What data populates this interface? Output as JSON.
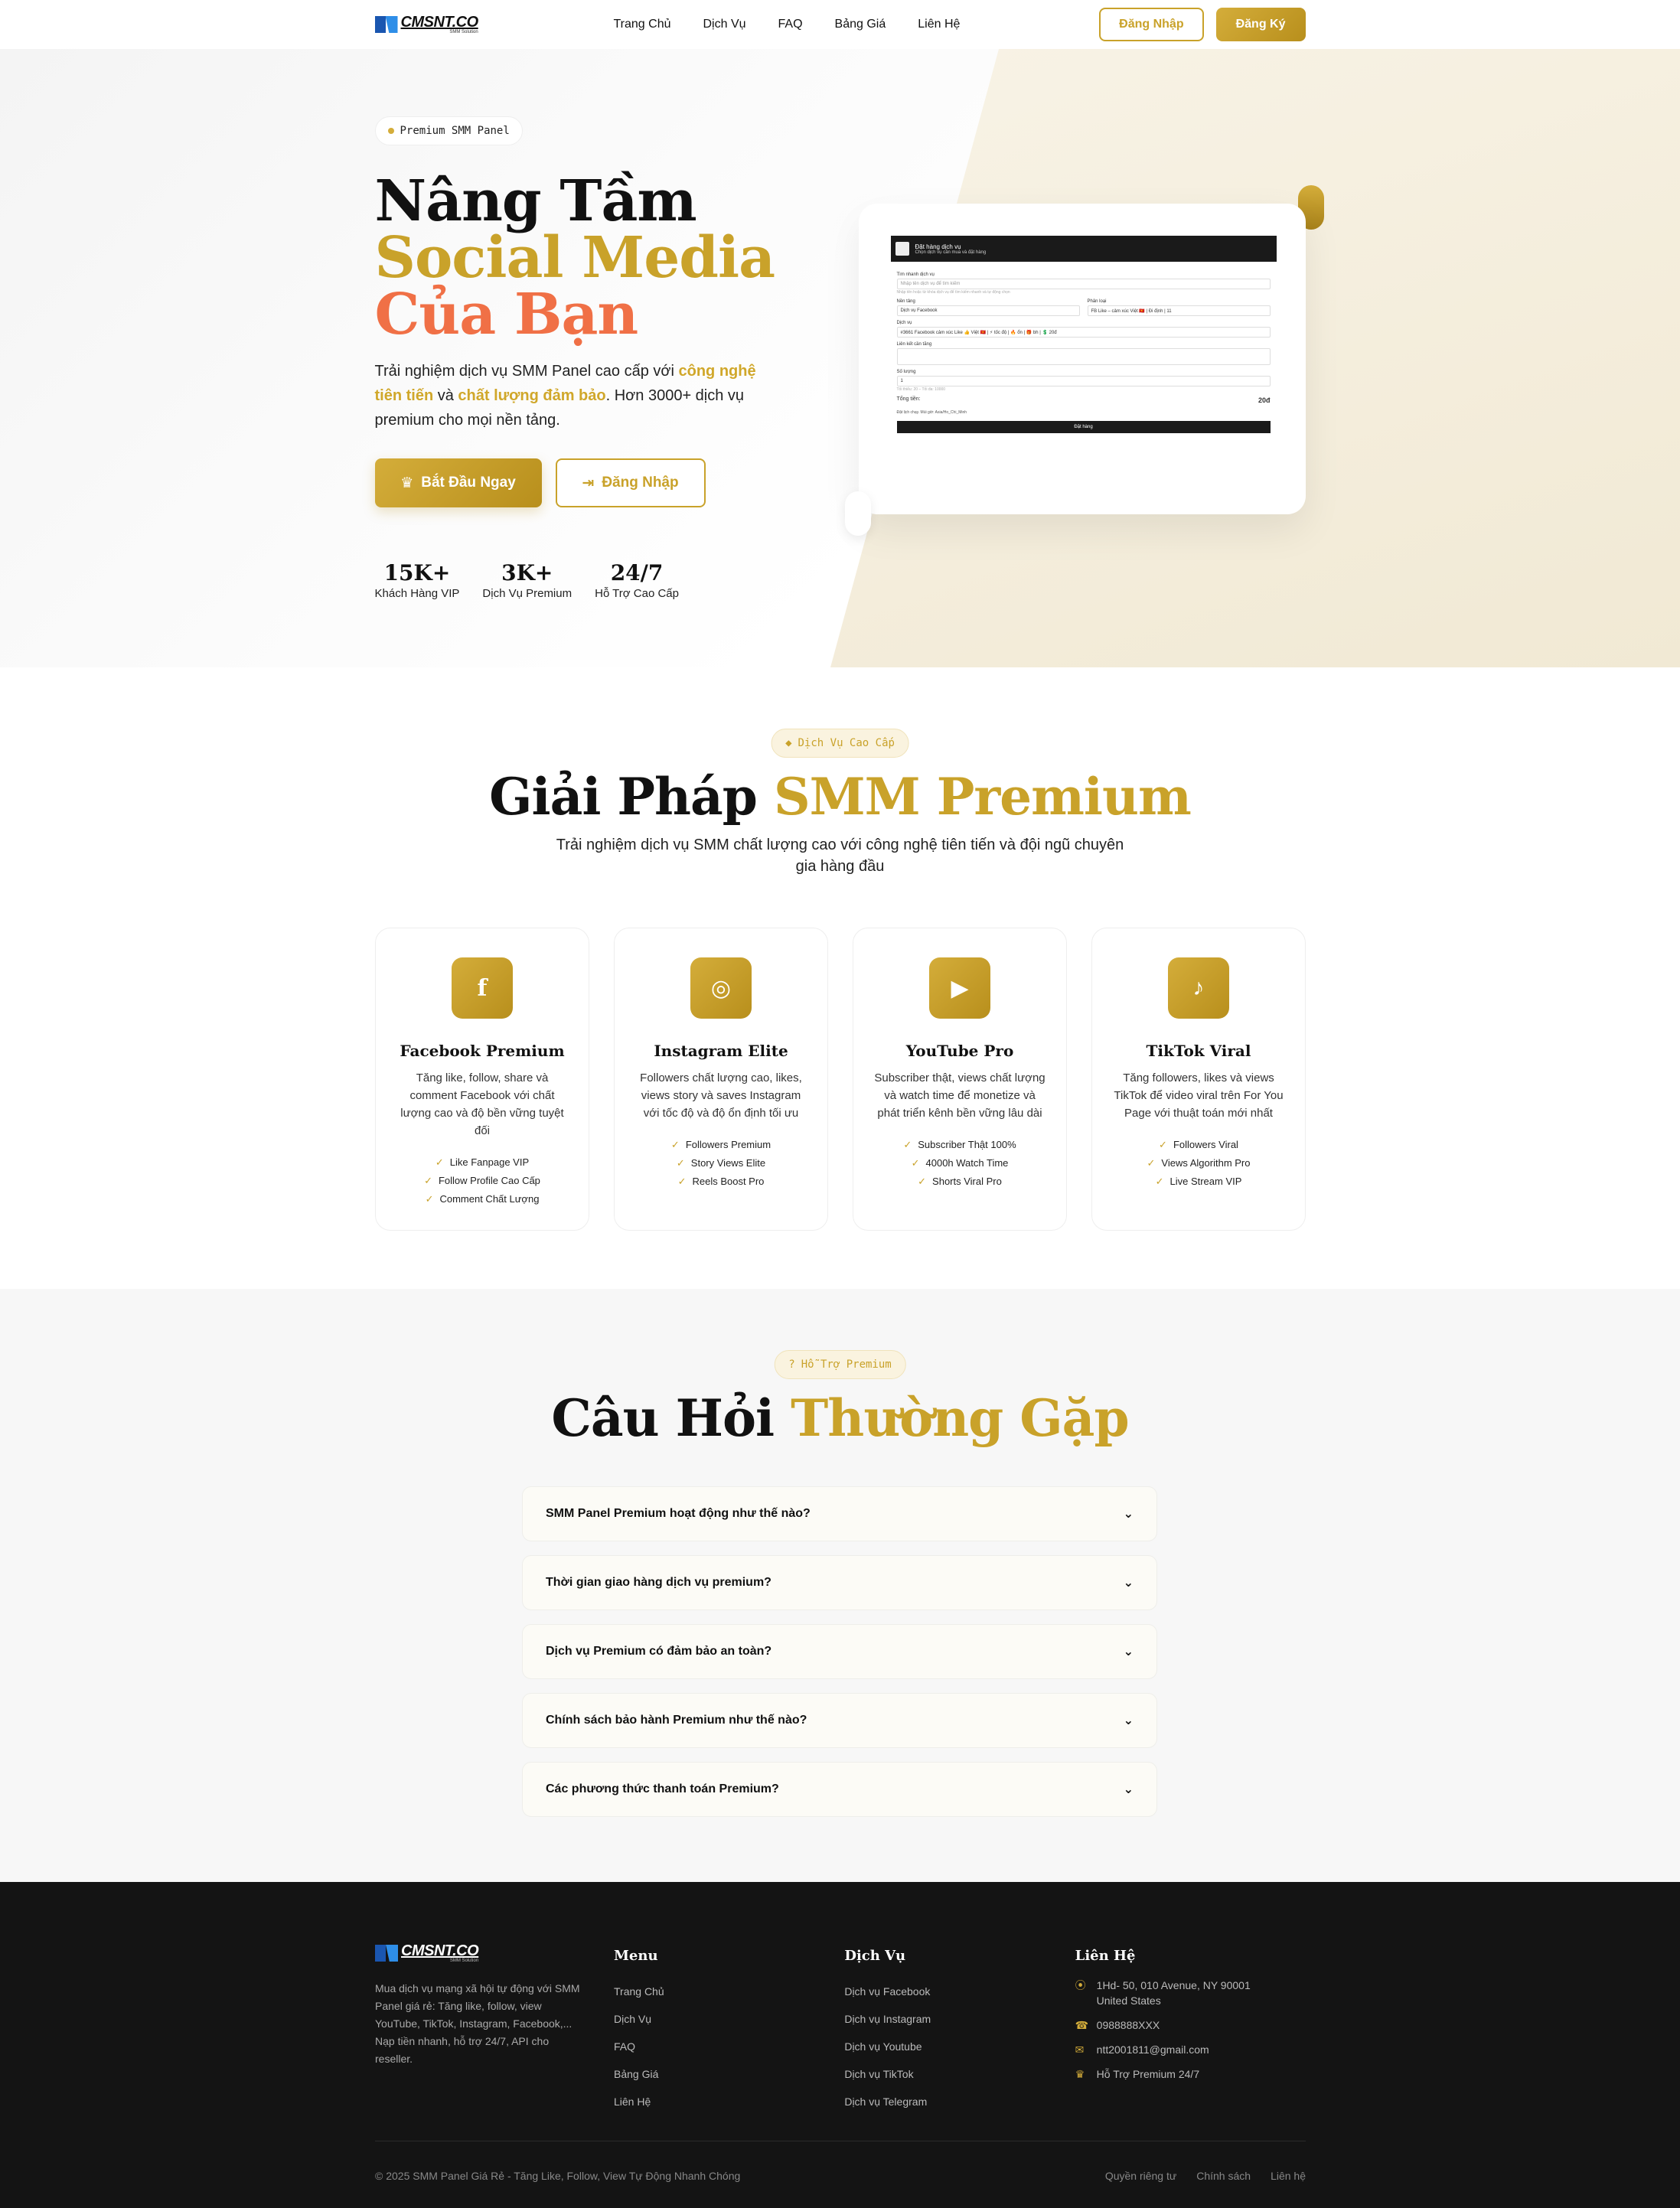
{
  "nav": {
    "logo_text": "CMSNT.CO",
    "logo_sub": "SMM Solution",
    "menu": [
      "Trang Chủ",
      "Dịch Vụ",
      "FAQ",
      "Bảng Giá",
      "Liên Hệ"
    ],
    "login": "Đăng Nhập",
    "register": "Đăng Ký"
  },
  "hero": {
    "badge": "Premium SMM Panel",
    "title_1": "Nâng Tầm",
    "title_2": "Social Media",
    "title_3": "Của Bạn",
    "desc_1": "Trải nghiệm dịch vụ SMM Panel cao cấp với ",
    "desc_hl_1": "công nghệ tiên tiến",
    "desc_2": " và ",
    "desc_hl_2": "chất lượng đảm bảo",
    "desc_3": ". Hơn 3000+ dịch vụ premium cho mọi nền tảng.",
    "btn_start": "Bắt Đầu Ngay",
    "btn_login": "Đăng Nhập",
    "stats": [
      {
        "num": "15K+",
        "label": "Khách Hàng VIP"
      },
      {
        "num": "3K+",
        "label": "Dịch Vụ Premium"
      },
      {
        "num": "24/7",
        "label": "Hỗ Trợ Cao Cấp"
      }
    ],
    "mock": {
      "head_title": "Đặt hàng dịch vụ",
      "head_sub": "Chọn dịch vụ cần mua và đặt hàng",
      "search_label": "Tìm nhanh dịch vụ",
      "search_placeholder": "Nhập tên dịch vụ để tìm kiếm",
      "search_hint": "Nhập tên hoặc từ khóa dịch vụ để tìm kiếm nhanh và tự động chọn",
      "platform_label": "Nền tảng",
      "platform_value": "Dịch vụ Facebook",
      "category_label": "Phân loại",
      "category_value": "FB Like – cảm xúc Việt 🇻🇳 | Đi định | 11",
      "service_label": "Dịch vụ",
      "service_value": "#3661 Facebook cảm xúc Like 👍 Việt 🇻🇳 | ⚡ tốc độ | 🔥 ổn | 🎁 bh | 💲 20đ",
      "link_label": "Liên kết cần tăng",
      "qty_label": "Số lượng",
      "qty_value": "1",
      "qty_hint": "Tối thiểu: 20 – Tối đa: 10000",
      "total_label": "Tổng tiền:",
      "total_value": "20đ",
      "schedule": "Đặt lịch chạy. Múi giờ: Asia/Ho_Chi_Minh",
      "submit": "Đặt hàng"
    }
  },
  "services": {
    "pill": "Dịch Vụ Cao Cấp",
    "title_1": "Giải Pháp",
    "title_2": "SMM Premium",
    "desc": "Trải nghiệm dịch vụ SMM chất lượng cao với công nghệ tiên tiến và đội ngũ chuyên gia hàng đầu",
    "cards": [
      {
        "icon": "facebook-icon",
        "glyph": "f",
        "title": "Facebook Premium",
        "desc": "Tăng like, follow, share và comment Facebook với chất lượng cao và độ bền vững tuyệt đối",
        "items": [
          "Like Fanpage VIP",
          "Follow Profile Cao Cấp",
          "Comment Chất Lượng"
        ]
      },
      {
        "icon": "instagram-icon",
        "glyph": "◎",
        "title": "Instagram Elite",
        "desc": "Followers chất lượng cao, likes, views story và saves Instagram với tốc độ và độ ổn định tối ưu",
        "items": [
          "Followers Premium",
          "Story Views Elite",
          "Reels Boost Pro"
        ]
      },
      {
        "icon": "youtube-icon",
        "glyph": "▶",
        "title": "YouTube Pro",
        "desc": "Subscriber thật, views chất lượng và watch time để monetize và phát triển kênh bền vững lâu dài",
        "items": [
          "Subscriber Thật 100%",
          "4000h Watch Time",
          "Shorts Viral Pro"
        ]
      },
      {
        "icon": "tiktok-icon",
        "glyph": "♪",
        "title": "TikTok Viral",
        "desc": "Tăng followers, likes và views TikTok để video viral trên For You Page với thuật toán mới nhất",
        "items": [
          "Followers Viral",
          "Views Algorithm Pro",
          "Live Stream VIP"
        ]
      }
    ]
  },
  "faq": {
    "pill": "Hỗ Trợ Premium",
    "title_1": "Câu Hỏi",
    "title_2": "Thường Gặp",
    "items": [
      "SMM Panel Premium hoạt động như thế nào?",
      "Thời gian giao hàng dịch vụ premium?",
      "Dịch vụ Premium có đảm bảo an toàn?",
      "Chính sách bảo hành Premium như thế nào?",
      "Các phương thức thanh toán Premium?"
    ]
  },
  "footer": {
    "desc": "Mua dịch vụ mạng xã hội tự động với SMM Panel giá rẻ: Tăng like, follow, view YouTube, TikTok, Instagram, Facebook,... Nạp tiền nhanh, hỗ trợ 24/7, API cho reseller.",
    "menu_title": "Menu",
    "menu": [
      "Trang Chủ",
      "Dịch Vụ",
      "FAQ",
      "Bảng Giá",
      "Liên Hệ"
    ],
    "services_title": "Dịch Vụ",
    "services": [
      "Dịch vụ Facebook",
      "Dịch vụ Instagram",
      "Dịch vụ Youtube",
      "Dịch vụ TikTok",
      "Dịch vụ Telegram"
    ],
    "contact_title": "Liên Hệ",
    "address": "1Hd- 50, 010 Avenue, NY 90001 United States",
    "phone": "0988888XXX",
    "email": "ntt2001811@gmail.com",
    "support": "Hỗ Trợ Premium 24/7",
    "copyright": "© 2025 SMM Panel Giá Rẻ - Tăng Like, Follow, View Tự Động Nhanh Chóng",
    "bottom_links": [
      "Quyền riêng tư",
      "Chính sách",
      "Liên hệ"
    ]
  }
}
